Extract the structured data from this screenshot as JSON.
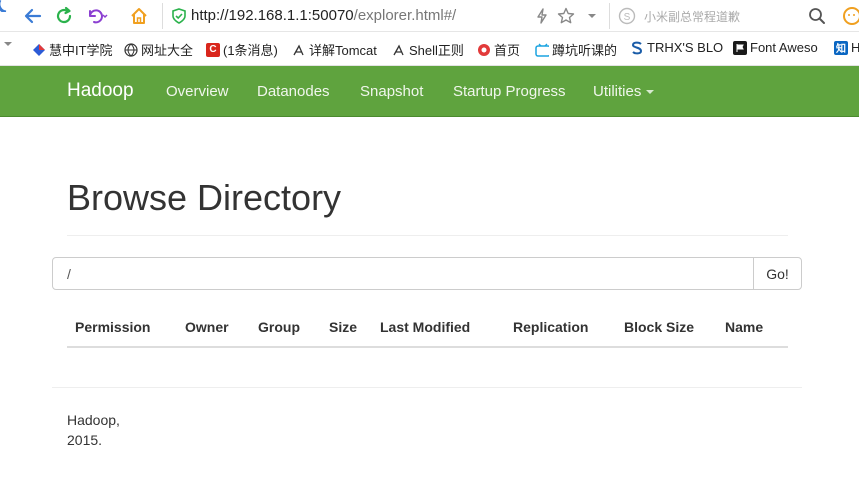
{
  "browser": {
    "url_host": "http://192.168.1.1:50070",
    "url_path": "/explorer.html#/",
    "search_placeholder": "小米副总常程道歉"
  },
  "bookmarks": [
    {
      "label": "慧中IT学院"
    },
    {
      "label": "网址大全"
    },
    {
      "label": "(1条消息)"
    },
    {
      "label": "详解Tomcat"
    },
    {
      "label": "Shell正则"
    },
    {
      "label": "首页"
    },
    {
      "label": "蹲坑听课的"
    },
    {
      "label": "TRHX'S BLO"
    },
    {
      "label": "Font Aweso"
    },
    {
      "label": "H"
    }
  ],
  "navbar": {
    "brand": "Hadoop",
    "links": [
      "Overview",
      "Datanodes",
      "Snapshot",
      "Startup Progress",
      "Utilities"
    ],
    "color": "#5fa33e"
  },
  "page": {
    "title": "Browse Directory",
    "path_value": "/",
    "go_label": "Go!",
    "columns": [
      "Permission",
      "Owner",
      "Group",
      "Size",
      "Last Modified",
      "Replication",
      "Block Size",
      "Name"
    ],
    "footer_line1": "Hadoop,",
    "footer_line2": "2015."
  }
}
